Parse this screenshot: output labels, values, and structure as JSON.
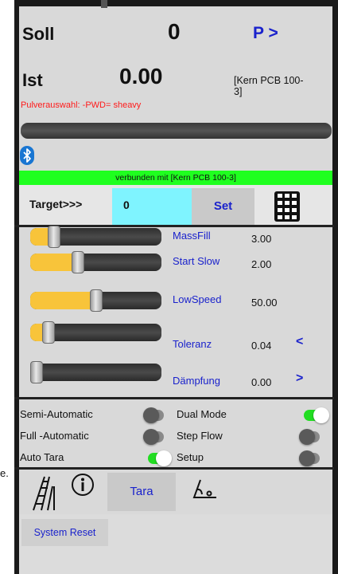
{
  "header": {
    "soll_label": "Soll",
    "soll_value": "0",
    "program_button": "P >",
    "ist_label": "Ist",
    "ist_value": "0.00",
    "scale_name": "[Kern PCB 100-3]",
    "powder_text": "Pulverauswahl: -PWD= sheavy"
  },
  "connection": {
    "status_text": "verbunden mit [Kern PCB 100-3]",
    "bluetooth_icon": "bluetooth-icon"
  },
  "target": {
    "label": "Target>>>",
    "value": "0",
    "set_button": "Set",
    "keypad_icon": "keypad-icon"
  },
  "sliders": [
    {
      "label": "MassFill",
      "value": "3.00",
      "level": 0.15
    },
    {
      "label": "Start Slow",
      "value": "2.00",
      "level": 0.35
    },
    {
      "label": "LowSpeed",
      "value": "50.00",
      "level": 0.5
    },
    {
      "label": "Toleranz",
      "value": "0.04",
      "level": 0.1
    },
    {
      "label": "Dämpfung",
      "value": "0.00",
      "level": 0.0
    }
  ],
  "nav_buttons": {
    "prev": "<",
    "next": ">"
  },
  "options": {
    "semi_automatic": {
      "label": "Semi-Automatic",
      "on": false
    },
    "full_automatic": {
      "label": "Full -Automatic",
      "on": false
    },
    "auto_tara": {
      "label": "Auto Tara",
      "on": true
    },
    "dual_mode": {
      "label": "Dual Mode",
      "on": true
    },
    "step_flow": {
      "label": "Step Flow",
      "on": false
    },
    "setup": {
      "label": "Setup",
      "on": false
    }
  },
  "tabs": {
    "ladder_icon": "ladder-icon",
    "info_icon": "info-icon",
    "tara_label": "Tara",
    "angle_icon": "angle-icon"
  },
  "system_reset": "System Reset",
  "colors": {
    "accent_blue": "#1a22cc",
    "connected_green": "#1fff1f",
    "target_cyan": "#7ff4ff",
    "slider_fill": "#f8c43a",
    "toggle_on": "#22dd22",
    "warning_red": "#ff1a1a"
  }
}
